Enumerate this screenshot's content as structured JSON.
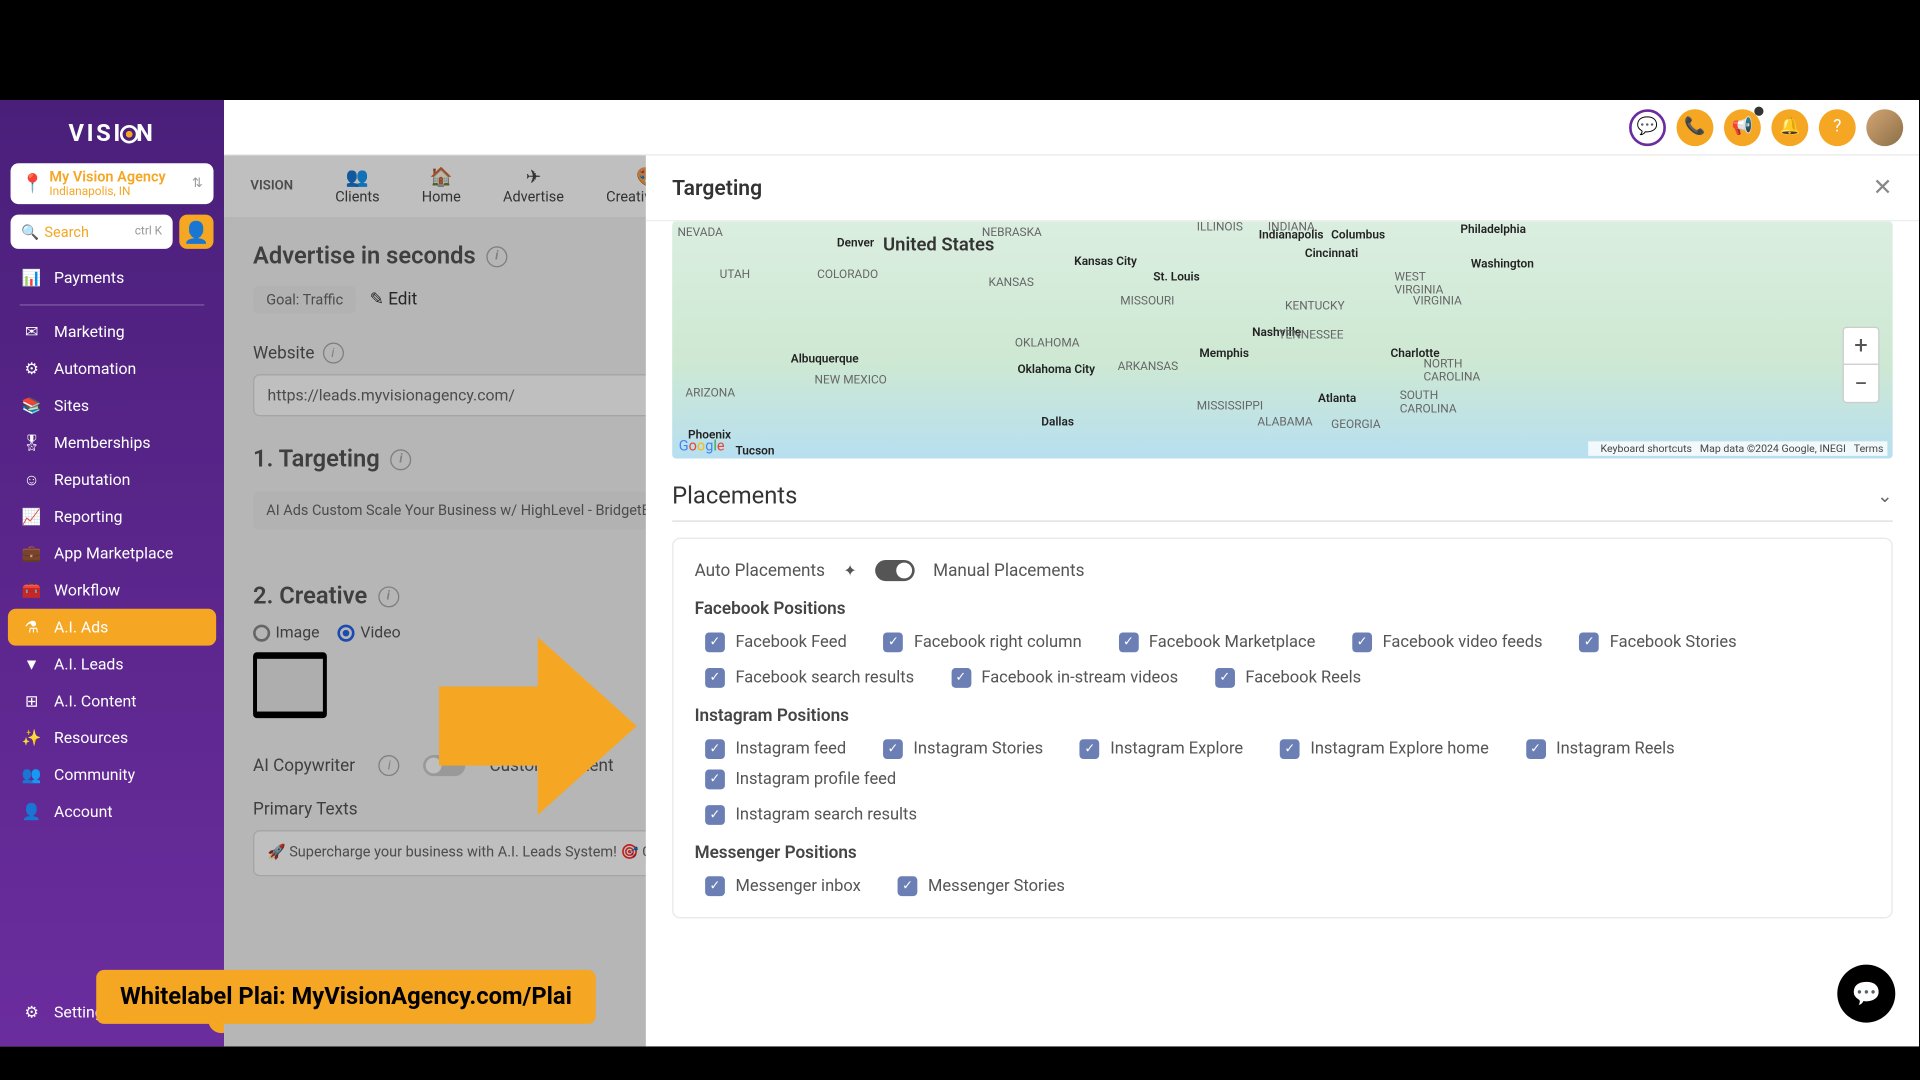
{
  "logo": "VISI   N",
  "agency": {
    "name": "My Vision Agency",
    "location": "Indianapolis, IN"
  },
  "search": {
    "placeholder": "Search",
    "shortcut": "ctrl K"
  },
  "nav": {
    "payments": "Payments",
    "marketing": "Marketing",
    "automation": "Automation",
    "sites": "Sites",
    "memberships": "Memberships",
    "reputation": "Reputation",
    "reporting": "Reporting",
    "marketplace": "App Marketplace",
    "workflow": "Workflow",
    "aiads": "A.I. Ads",
    "aileads": "A.I. Leads",
    "aicontent": "A.I. Content",
    "resources": "Resources",
    "community": "Community",
    "account": "Account",
    "settings": "Settings"
  },
  "subtabs": {
    "brand": "VISION",
    "clients": "Clients",
    "home": "Home",
    "advertise": "Advertise",
    "creative": "Creative Hub"
  },
  "page": {
    "title": "Advertise in seconds",
    "goal": "Goal: Traffic",
    "edit": "Edit",
    "website_label": "Website",
    "website_url": "https://leads.myvisionagency.com/",
    "step1": "1.  Targeting",
    "targeting_chip": "AI Ads Custom Scale Your Business w/ HighLevel - BridgetBo",
    "step2": "2. Creative",
    "image_opt": "Image",
    "video_opt": "Video",
    "ai_copywriter": "AI Copywriter",
    "custom_content": "Custom Content",
    "primary_texts": "Primary Texts",
    "pt_copy": "🚀 Supercharge your business with A.I. Leads System! 🎯 Generate high-quality leads for your business using the power of artificial intelligence. 🤖"
  },
  "modal": {
    "title": "Targeting",
    "map": {
      "center_label": "United States",
      "zoom_in": "+",
      "zoom_out": "−",
      "attr1": "Keyboard shortcuts",
      "attr2": "Map data ©2024 Google, INEGI",
      "attr3": "Terms",
      "denver": "Denver",
      "kc": "Kansas City",
      "stl": "St. Louis",
      "cinci": "Cincinnati",
      "columbus": "Columbus",
      "indy": "Indianapolis",
      "philly": "Philadelphia",
      "wash": "Washington",
      "nash": "Nashville",
      "memphis": "Memphis",
      "charlotte": "Charlotte",
      "atlanta": "Atlanta",
      "dallas": "Dallas",
      "okc": "Oklahoma City",
      "phoenix": "Phoenix",
      "tucson": "Tucson",
      "abq": "Albuquerque",
      "nevada": "NEVADA",
      "utah": "UTAH",
      "colorado": "COLORADO",
      "kansas": "KANSAS",
      "missouri": "MISSOURI",
      "kentucky": "KENTUCKY",
      "tennessee": "TENNESSEE",
      "virginia": "VIRGINIA",
      "wv": "WEST\nVIRGINIA",
      "nc": "NORTH\nCAROLINA",
      "sc": "SOUTH\nCAROLINA",
      "ga": "GEORGIA",
      "al": "ALABAMA",
      "ms": "MISSISSIPPI",
      "ar": "ARKANSAS",
      "ok": "OKLAHOMA",
      "nm": "NEW MEXICO",
      "az": "ARIZONA",
      "indiana": "INDIANA",
      "illinois": "ILLINOIS",
      "nebraska": "NEBRASKA"
    },
    "placements": {
      "title": "Placements",
      "auto": "Auto Placements",
      "manual": "Manual Placements",
      "fb_title": "Facebook Positions",
      "fb": {
        "feed": "Facebook Feed",
        "right": "Facebook right column",
        "marketplace": "Facebook Marketplace",
        "video": "Facebook video feeds",
        "stories": "Facebook Stories",
        "search": "Facebook search results",
        "instream": "Facebook in-stream videos",
        "reels": "Facebook Reels"
      },
      "ig_title": "Instagram Positions",
      "ig": {
        "feed": "Instagram feed",
        "stories": "Instagram Stories",
        "explore": "Instagram Explore",
        "explorehome": "Instagram Explore home",
        "reels": "Instagram Reels",
        "profile": "Instagram profile feed",
        "search": "Instagram search results"
      },
      "msg_title": "Messenger Positions",
      "msg": {
        "inbox": "Messenger inbox",
        "stories": "Messenger Stories"
      }
    }
  },
  "banner": "Whitelabel Plai: MyVisionAgency.com/Plai"
}
